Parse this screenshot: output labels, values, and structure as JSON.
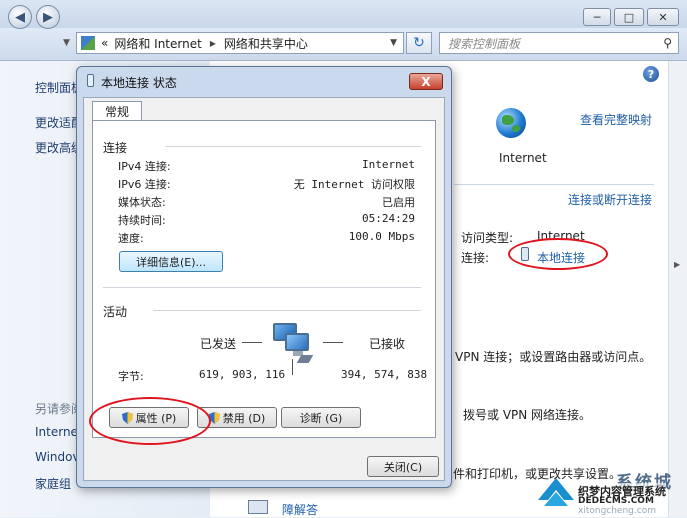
{
  "window": {
    "caption_buttons": [
      "minimize",
      "maximize",
      "close"
    ],
    "nav": {
      "back": "back",
      "forward": "forward"
    },
    "address": {
      "chevrons": "«",
      "crumbs": [
        "网络和 Internet",
        "网络和共享中心"
      ]
    },
    "search": {
      "placeholder": "搜索控制面板"
    },
    "help": "?"
  },
  "sidebar": {
    "items": [
      "控制面板",
      "更改适配",
      "更改高级"
    ],
    "see_also": {
      "heading": "另请参阅",
      "items": [
        "Interne",
        "Windov",
        "家庭组"
      ]
    }
  },
  "main": {
    "view_full_map": "查看完整映射",
    "internet_label": "Internet",
    "connect_disconnect": "连接或断开连接",
    "access_type_label": "访问类型:",
    "access_type_value": "Internet",
    "connection_label": "连接:",
    "connection_value": "本地连接",
    "partial_text_1": "VPN 连接；或设置路由器或访问点。",
    "partial_text_2": "拨号或 VPN 网络连接。",
    "partial_text_3": "件和打印机，或更改共享设置。",
    "partial_text_4": "障解答"
  },
  "dialog": {
    "title": "本地连接 状态",
    "close_label": "X",
    "tab": "常规",
    "connection": {
      "heading": "连接",
      "rows": [
        {
          "label": "IPv4 连接:",
          "value": "Internet"
        },
        {
          "label": "IPv6 连接:",
          "value": "无 Internet 访问权限"
        },
        {
          "label": "媒体状态:",
          "value": "已启用"
        },
        {
          "label": "持续时间:",
          "value": "05:24:29"
        },
        {
          "label": "速度:",
          "value": "100.0 Mbps"
        }
      ],
      "details_button": "详细信息(E)..."
    },
    "activity": {
      "heading": "活动",
      "sent_label": "已发送",
      "received_label": "已接收",
      "bytes_label": "字节:",
      "bytes_sent": "619, 903, 116",
      "bytes_received": "394, 574, 838"
    },
    "buttons": {
      "properties": "属性 (P)",
      "disable": "禁用 (D)",
      "diagnose": "诊断 (G)",
      "close": "关闭(C)"
    }
  },
  "watermark": {
    "line1": "织梦内容管理系统",
    "line2": "DEDECMS.COM",
    "line3": "xitongcheng.com",
    "brand": "系统城"
  },
  "colors": {
    "accent_red": "#e0141e",
    "link_blue": "#1f5ea8"
  }
}
